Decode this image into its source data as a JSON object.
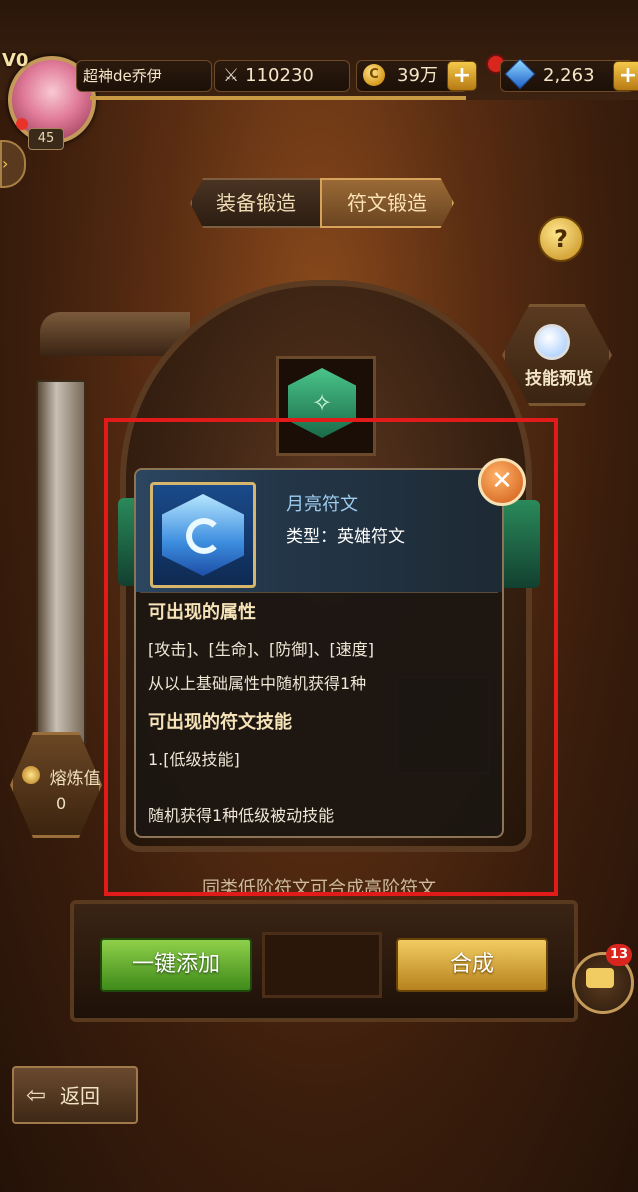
{
  "player": {
    "vip": "V0",
    "name": "超神de乔伊",
    "level": "45",
    "power": "110230",
    "gold": "39万",
    "gems": "2,263"
  },
  "tabs": [
    {
      "label": "装备锻造"
    },
    {
      "label": "符文锻造"
    }
  ],
  "skill_preview_label": "技能预览",
  "smelt": {
    "label": "熔炼值",
    "value": "0"
  },
  "popup": {
    "rune_name": "月亮符文",
    "rune_type": "类型：英雄符文",
    "attr_title": "可出现的属性",
    "attr_list": "[攻击]、[生命]、[防御]、[速度]",
    "attr_desc": "从以上基础属性中随机获得1种",
    "skill_title": "可出现的符文技能",
    "skill_list": "1.[低级技能]",
    "skill_desc": "随机获得1种低级被动技能"
  },
  "hint": "同类低阶符文可合成高阶符文",
  "buttons": {
    "auto_add": "一键添加",
    "synthesize": "合成",
    "back": "返回"
  },
  "chat_badge": "13",
  "icons": {
    "power": "crossed-swords-icon",
    "gold": "coin-icon",
    "gems": "gem-icon",
    "help": "question-icon",
    "close": "close-icon"
  },
  "colors": {
    "highlight": "#e11a1a",
    "green_button": "#5fae2a",
    "gold_button": "#d8a23a"
  }
}
